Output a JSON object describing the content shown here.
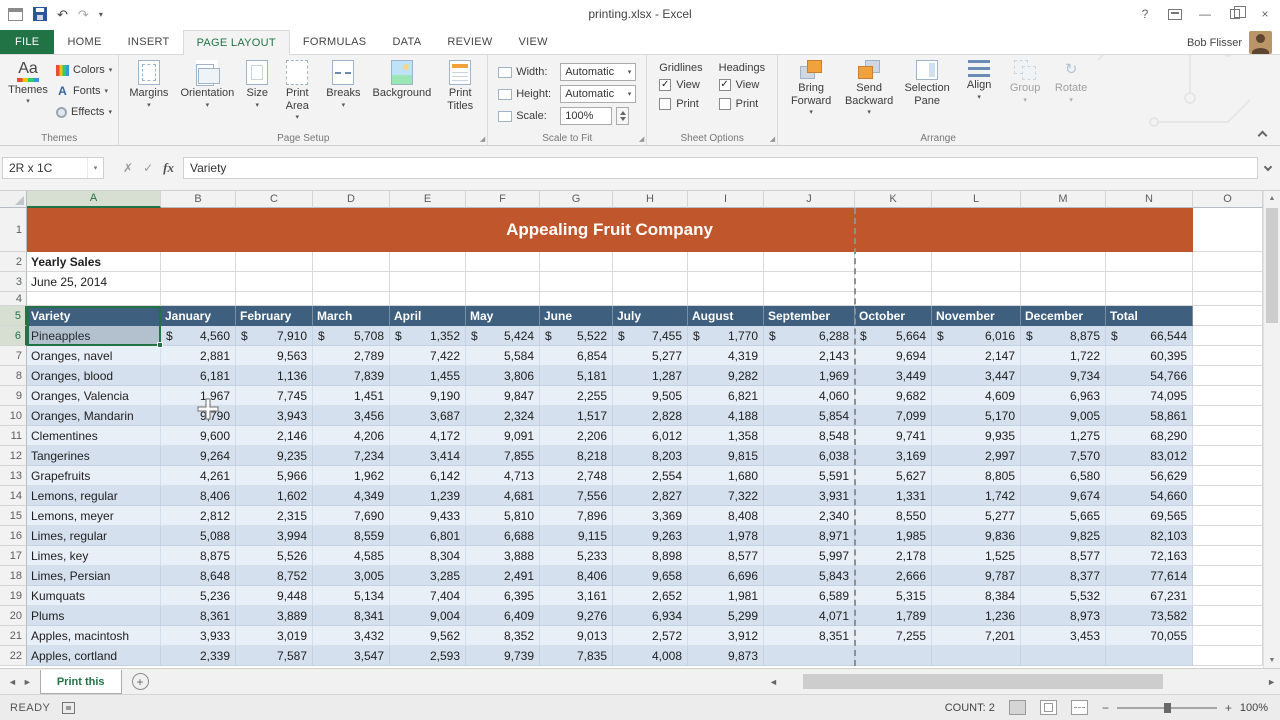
{
  "colors": {
    "accent_green": "#217346",
    "title_band": "#C0562C",
    "table_header": "#3E5F7E",
    "band_dark": "#D5E0EE",
    "band_light": "#E9EFF7"
  },
  "window": {
    "title": "printing.xlsx - Excel"
  },
  "glyphs": {
    "undo": "↶",
    "redo": "↷",
    "dropdown": "▾",
    "check": "✓",
    "cancel": "✗",
    "fx": "fx",
    "help": "?",
    "close": "×",
    "minimize": "—",
    "prev": "◄",
    "next": "►",
    "up": "▲",
    "down": "▼",
    "add": "+",
    "launcher": "◢",
    "themes_icon": "Aa",
    "fonts_icon": "A",
    "rotate_icon": "↻"
  },
  "ribbon": {
    "tabs": [
      "FILE",
      "HOME",
      "INSERT",
      "PAGE LAYOUT",
      "FORMULAS",
      "DATA",
      "REVIEW",
      "VIEW"
    ],
    "active_tab": "PAGE LAYOUT",
    "user_name": "Bob Flisser",
    "groups": {
      "themes": {
        "title": "Themes",
        "big_button": "Themes",
        "items": [
          "Colors",
          "Fonts",
          "Effects"
        ]
      },
      "page_setup": {
        "title": "Page Setup",
        "items": [
          "Margins",
          "Orientation",
          "Size",
          "Print Area",
          "Breaks",
          "Background",
          "Print Titles"
        ]
      },
      "scale_to_fit": {
        "title": "Scale to Fit",
        "fields": [
          {
            "label": "Width:",
            "value": "Automatic"
          },
          {
            "label": "Height:",
            "value": "Automatic"
          },
          {
            "label": "Scale:",
            "value": "100%"
          }
        ]
      },
      "sheet_options": {
        "title": "Sheet Options",
        "subgroups": [
          {
            "title": "Gridlines",
            "options": [
              {
                "label": "View",
                "checked": true
              },
              {
                "label": "Print",
                "checked": false
              }
            ]
          },
          {
            "title": "Headings",
            "options": [
              {
                "label": "View",
                "checked": true
              },
              {
                "label": "Print",
                "checked": false
              }
            ]
          }
        ]
      },
      "arrange": {
        "title": "Arrange",
        "items": [
          "Bring Forward",
          "Send Backward",
          "Selection Pane",
          "Align",
          "Group",
          "Rotate"
        ]
      }
    }
  },
  "formula_bar": {
    "name_box": "2R x 1C",
    "value": "Variety"
  },
  "sheet": {
    "columns": [
      "A",
      "B",
      "C",
      "D",
      "E",
      "F",
      "G",
      "H",
      "I",
      "J",
      "K",
      "L",
      "M",
      "N",
      "O"
    ],
    "title": "Appealing Fruit Company",
    "row2_label": "Yearly Sales",
    "row3_label": "June 25, 2014",
    "currency_symbol": "$",
    "headers": [
      "Variety",
      "January",
      "February",
      "March",
      "April",
      "May",
      "June",
      "July",
      "August",
      "September",
      "October",
      "November",
      "December",
      "Total"
    ],
    "selection": {
      "rows": [
        5,
        6
      ],
      "col": "A"
    },
    "rows": [
      {
        "r": 6,
        "label": "Pineapples",
        "currency": true,
        "values": [
          "4,560",
          "7,910",
          "5,708",
          "1,352",
          "5,424",
          "5,522",
          "7,455",
          "1,770",
          "6,288",
          "5,664",
          "6,016",
          "8,875"
        ],
        "total": "66,544"
      },
      {
        "r": 7,
        "label": "Oranges, navel",
        "values": [
          "2,881",
          "9,563",
          "2,789",
          "7,422",
          "5,584",
          "6,854",
          "5,277",
          "4,319",
          "2,143",
          "9,694",
          "2,147",
          "1,722"
        ],
        "total": "60,395"
      },
      {
        "r": 8,
        "label": "Oranges, blood",
        "values": [
          "6,181",
          "1,136",
          "7,839",
          "1,455",
          "3,806",
          "5,181",
          "1,287",
          "9,282",
          "1,969",
          "3,449",
          "3,447",
          "9,734"
        ],
        "total": "54,766"
      },
      {
        "r": 9,
        "label": "Oranges, Valencia",
        "values": [
          "1,967",
          "7,745",
          "1,451",
          "9,190",
          "9,847",
          "2,255",
          "9,505",
          "6,821",
          "4,060",
          "9,682",
          "4,609",
          "6,963"
        ],
        "total": "74,095"
      },
      {
        "r": 10,
        "label": "Oranges, Mandarin",
        "values": [
          "9,790",
          "3,943",
          "3,456",
          "3,687",
          "2,324",
          "1,517",
          "2,828",
          "4,188",
          "5,854",
          "7,099",
          "5,170",
          "9,005"
        ],
        "total": "58,861"
      },
      {
        "r": 11,
        "label": "Clementines",
        "values": [
          "9,600",
          "2,146",
          "4,206",
          "4,172",
          "9,091",
          "2,206",
          "6,012",
          "1,358",
          "8,548",
          "9,741",
          "9,935",
          "1,275"
        ],
        "total": "68,290"
      },
      {
        "r": 12,
        "label": "Tangerines",
        "values": [
          "9,264",
          "9,235",
          "7,234",
          "3,414",
          "7,855",
          "8,218",
          "8,203",
          "9,815",
          "6,038",
          "3,169",
          "2,997",
          "7,570"
        ],
        "total": "83,012"
      },
      {
        "r": 13,
        "label": "Grapefruits",
        "values": [
          "4,261",
          "5,966",
          "1,962",
          "6,142",
          "4,713",
          "2,748",
          "2,554",
          "1,680",
          "5,591",
          "5,627",
          "8,805",
          "6,580"
        ],
        "total": "56,629"
      },
      {
        "r": 14,
        "label": "Lemons, regular",
        "values": [
          "8,406",
          "1,602",
          "4,349",
          "1,239",
          "4,681",
          "7,556",
          "2,827",
          "7,322",
          "3,931",
          "1,331",
          "1,742",
          "9,674"
        ],
        "total": "54,660"
      },
      {
        "r": 15,
        "label": "Lemons, meyer",
        "values": [
          "2,812",
          "2,315",
          "7,690",
          "9,433",
          "5,810",
          "7,896",
          "3,369",
          "8,408",
          "2,340",
          "8,550",
          "5,277",
          "5,665"
        ],
        "total": "69,565"
      },
      {
        "r": 16,
        "label": "Limes, regular",
        "values": [
          "5,088",
          "3,994",
          "8,559",
          "6,801",
          "6,688",
          "9,115",
          "9,263",
          "1,978",
          "8,971",
          "1,985",
          "9,836",
          "9,825"
        ],
        "total": "82,103"
      },
      {
        "r": 17,
        "label": "Limes, key",
        "values": [
          "8,875",
          "5,526",
          "4,585",
          "8,304",
          "3,888",
          "5,233",
          "8,898",
          "8,577",
          "5,997",
          "2,178",
          "1,525",
          "8,577"
        ],
        "total": "72,163"
      },
      {
        "r": 18,
        "label": "Limes, Persian",
        "values": [
          "8,648",
          "8,752",
          "3,005",
          "3,285",
          "2,491",
          "8,406",
          "9,658",
          "6,696",
          "5,843",
          "2,666",
          "9,787",
          "8,377"
        ],
        "total": "77,614"
      },
      {
        "r": 19,
        "label": "Kumquats",
        "values": [
          "5,236",
          "9,448",
          "5,134",
          "7,404",
          "6,395",
          "3,161",
          "2,652",
          "1,981",
          "6,589",
          "5,315",
          "8,384",
          "5,532"
        ],
        "total": "67,231"
      },
      {
        "r": 20,
        "label": "Plums",
        "values": [
          "8,361",
          "3,889",
          "8,341",
          "9,004",
          "6,409",
          "9,276",
          "6,934",
          "5,299",
          "4,071",
          "1,789",
          "1,236",
          "8,973"
        ],
        "total": "73,582"
      },
      {
        "r": 21,
        "label": "Apples, macintosh",
        "values": [
          "3,933",
          "3,019",
          "3,432",
          "9,562",
          "8,352",
          "9,013",
          "2,572",
          "3,912",
          "8,351",
          "7,255",
          "7,201",
          "3,453"
        ],
        "total": "70,055"
      },
      {
        "r": 22,
        "label": "Apples, cortland",
        "values": [
          "2,339",
          "7,587",
          "3,547",
          "2,593",
          "9,739",
          "7,835",
          "4,008",
          "9,873",
          "",
          "",
          "",
          ""
        ],
        "total": ""
      }
    ]
  },
  "sheet_tabs": {
    "active_sheet": "Print this"
  },
  "status": {
    "mode": "READY",
    "count": "COUNT: 2",
    "zoom_level": "100%"
  }
}
